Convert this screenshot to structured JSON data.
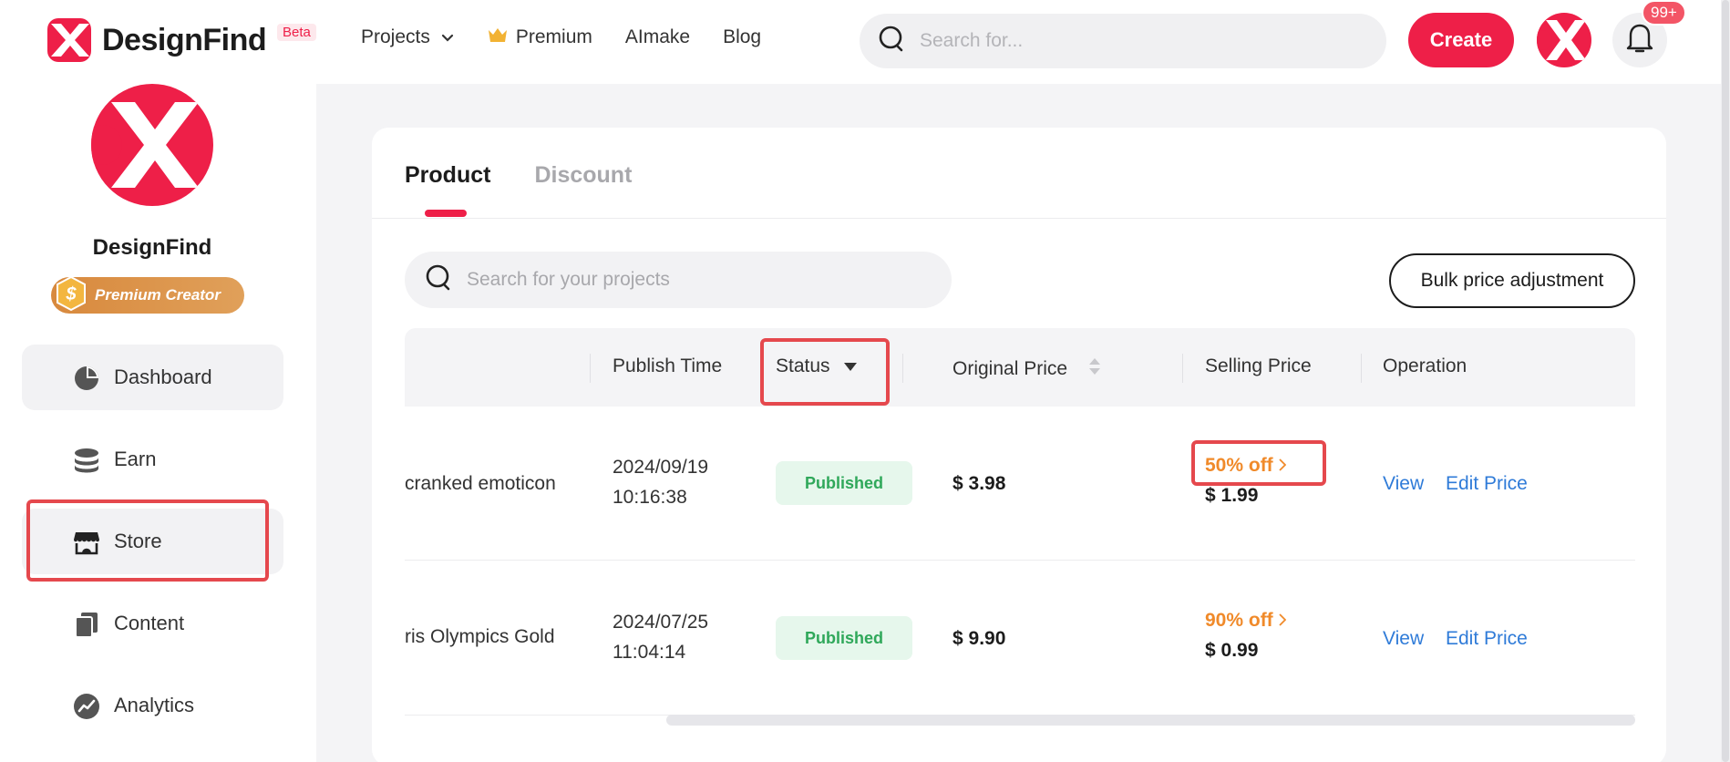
{
  "header": {
    "brand": "DesignFind",
    "beta": "Beta",
    "nav": {
      "projects": "Projects",
      "premium": "Premium",
      "aimake": "AImake",
      "blog": "Blog"
    },
    "search_placeholder": "Search for...",
    "create_label": "Create",
    "notification_count": "99+"
  },
  "sidebar": {
    "profile_name": "DesignFind",
    "badge_label": "Premium Creator",
    "items": [
      {
        "label": "Dashboard",
        "icon": "pie-chart-icon"
      },
      {
        "label": "Earn",
        "icon": "coins-stack-icon"
      },
      {
        "label": "Store",
        "icon": "store-icon",
        "active": true
      },
      {
        "label": "Content",
        "icon": "documents-icon"
      },
      {
        "label": "Analytics",
        "icon": "trend-icon"
      }
    ]
  },
  "main": {
    "tabs": [
      {
        "label": "Product",
        "active": true
      },
      {
        "label": "Discount",
        "active": false
      }
    ],
    "search_placeholder": "Search for your projects",
    "bulk_button": "Bulk price adjustment",
    "table": {
      "headers": {
        "publish_time": "Publish Time",
        "status": "Status",
        "original_price": "Original Price",
        "selling_price": "Selling Price",
        "operation": "Operation"
      },
      "rows": [
        {
          "name": "cranked emoticon",
          "publish_date": "2024/09/19",
          "publish_time": "10:16:38",
          "status": "Published",
          "original_price": "$ 3.98",
          "discount": "50% off",
          "selling_price": "$ 1.99",
          "view": "View",
          "edit": "Edit Price"
        },
        {
          "name": "ris Olympics Gold",
          "publish_date": "2024/07/25",
          "publish_time": "11:04:14",
          "status": "Published",
          "original_price": "$ 9.90",
          "discount": "90% off",
          "selling_price": "$ 0.99",
          "view": "View",
          "edit": "Edit Price"
        }
      ]
    }
  },
  "colors": {
    "brand": "#ee1f48",
    "link": "#2f7bd8",
    "discount": "#f08a2a",
    "published_bg": "#e6f7ec",
    "published_text": "#2fa85a",
    "highlight": "#e5484d"
  }
}
